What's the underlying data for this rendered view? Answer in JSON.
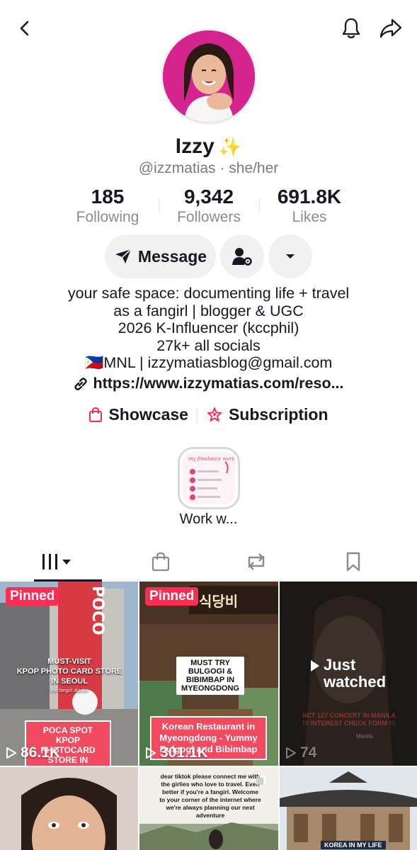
{
  "header": {
    "back_icon": "chevron-left-icon",
    "notification_icon": "bell-icon",
    "share_icon": "share-arrow-icon"
  },
  "profile": {
    "name": "Izzy",
    "name_emoji": "✨",
    "handle_line": "@izzmatias · she/her"
  },
  "stats": [
    {
      "value": "185",
      "label": "Following"
    },
    {
      "value": "9,342",
      "label": "Followers"
    },
    {
      "value": "691.8K",
      "label": "Likes"
    }
  ],
  "actions": {
    "message_label": "Message",
    "friends_icon": "user-gear-icon",
    "more_icon": "caret-down-icon"
  },
  "bio": {
    "line1": "your safe space: documenting life + travel",
    "line2": "as a fangirl | blogger & UGC",
    "line3": "2026 K-Influencer (kccphil)",
    "line4": "27k+ all socials",
    "line5_flag": "🇵🇭",
    "line5": "MNL | izzymatiasblog@gmail.com",
    "link": "https://www.izzymatias.com/reso..."
  },
  "features": {
    "showcase_label": "Showcase",
    "subscription_label": "Subscription",
    "accent": "#fe2c55"
  },
  "highlight": {
    "label": "Work w...",
    "card_title": "my freelance work"
  },
  "tabs": [
    {
      "name": "videos",
      "icon": "grid-bars-icon",
      "active": true
    },
    {
      "name": "shop",
      "icon": "shopping-bag-icon",
      "active": false
    },
    {
      "name": "reposts",
      "icon": "repost-icon",
      "active": false
    },
    {
      "name": "saved",
      "icon": "bookmark-icon",
      "active": false
    }
  ],
  "videos": [
    {
      "pinned_label": "Pinned",
      "views": "86.1K",
      "sign": "POCO",
      "top_caption_1": "MUST-VISIT",
      "top_caption_2": "KPOP PHOTO CARD STORE",
      "top_caption_3": "IN SEOUL",
      "small_caption": "the fangirl diaries",
      "red_caption": "POCA SPOT KPOP PHOTOCARD STORE IN HONGDAE"
    },
    {
      "pinned_label": "Pinned",
      "views": "301.1K",
      "sign": "식당비",
      "top_caption": "MUST TRY BULGOGI & BIBIMBAP IN MYEONGDONG",
      "red_caption": "Korean Restaurant in Myeongdong - Yummy Bulgogi and Bibimbap"
    },
    {
      "just_watched": "Just watched",
      "views": "74",
      "caption": "NCT 127 CONCERT IN MANILA !!! INTEREST CHECK FORM !!!",
      "location": "Manila"
    },
    {
      "caption": ""
    },
    {
      "caption": "dear tiktok please connect me with the girlies who love to travel. Even better if you're a fangirl. Welcome to your corner of the internet where we're always planning our next adventure"
    },
    {
      "caption": "KOREA IN MY LIFE"
    }
  ]
}
